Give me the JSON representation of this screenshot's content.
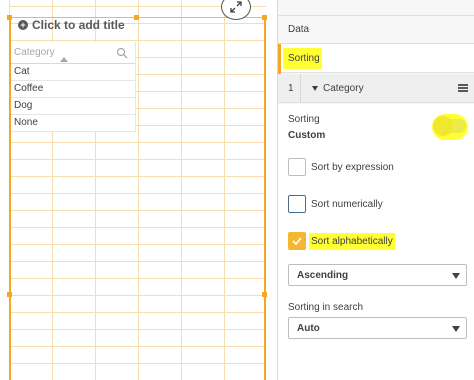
{
  "visualization": {
    "title_placeholder": "Click to add title",
    "table": {
      "column_header": "Category",
      "rows": [
        "Cat",
        "Coffee",
        "Dog",
        "None"
      ]
    }
  },
  "panel": {
    "sections": {
      "data": "Data",
      "sorting": "Sorting"
    },
    "dimension": {
      "index": "1",
      "label": "Category"
    },
    "sorting": {
      "label": "Sorting",
      "value": "Custom",
      "options": [
        {
          "label": "Sort by expression",
          "checked": false
        },
        {
          "label": "Sort numerically",
          "checked": false
        },
        {
          "label": "Sort alphabetically",
          "checked": true
        }
      ],
      "order_select": "Ascending",
      "search_label": "Sorting in search",
      "search_select": "Auto"
    }
  },
  "colors": {
    "selection": "#f5a623",
    "highlight": "#ffff33",
    "checkbox_checked": "#f5b731"
  }
}
